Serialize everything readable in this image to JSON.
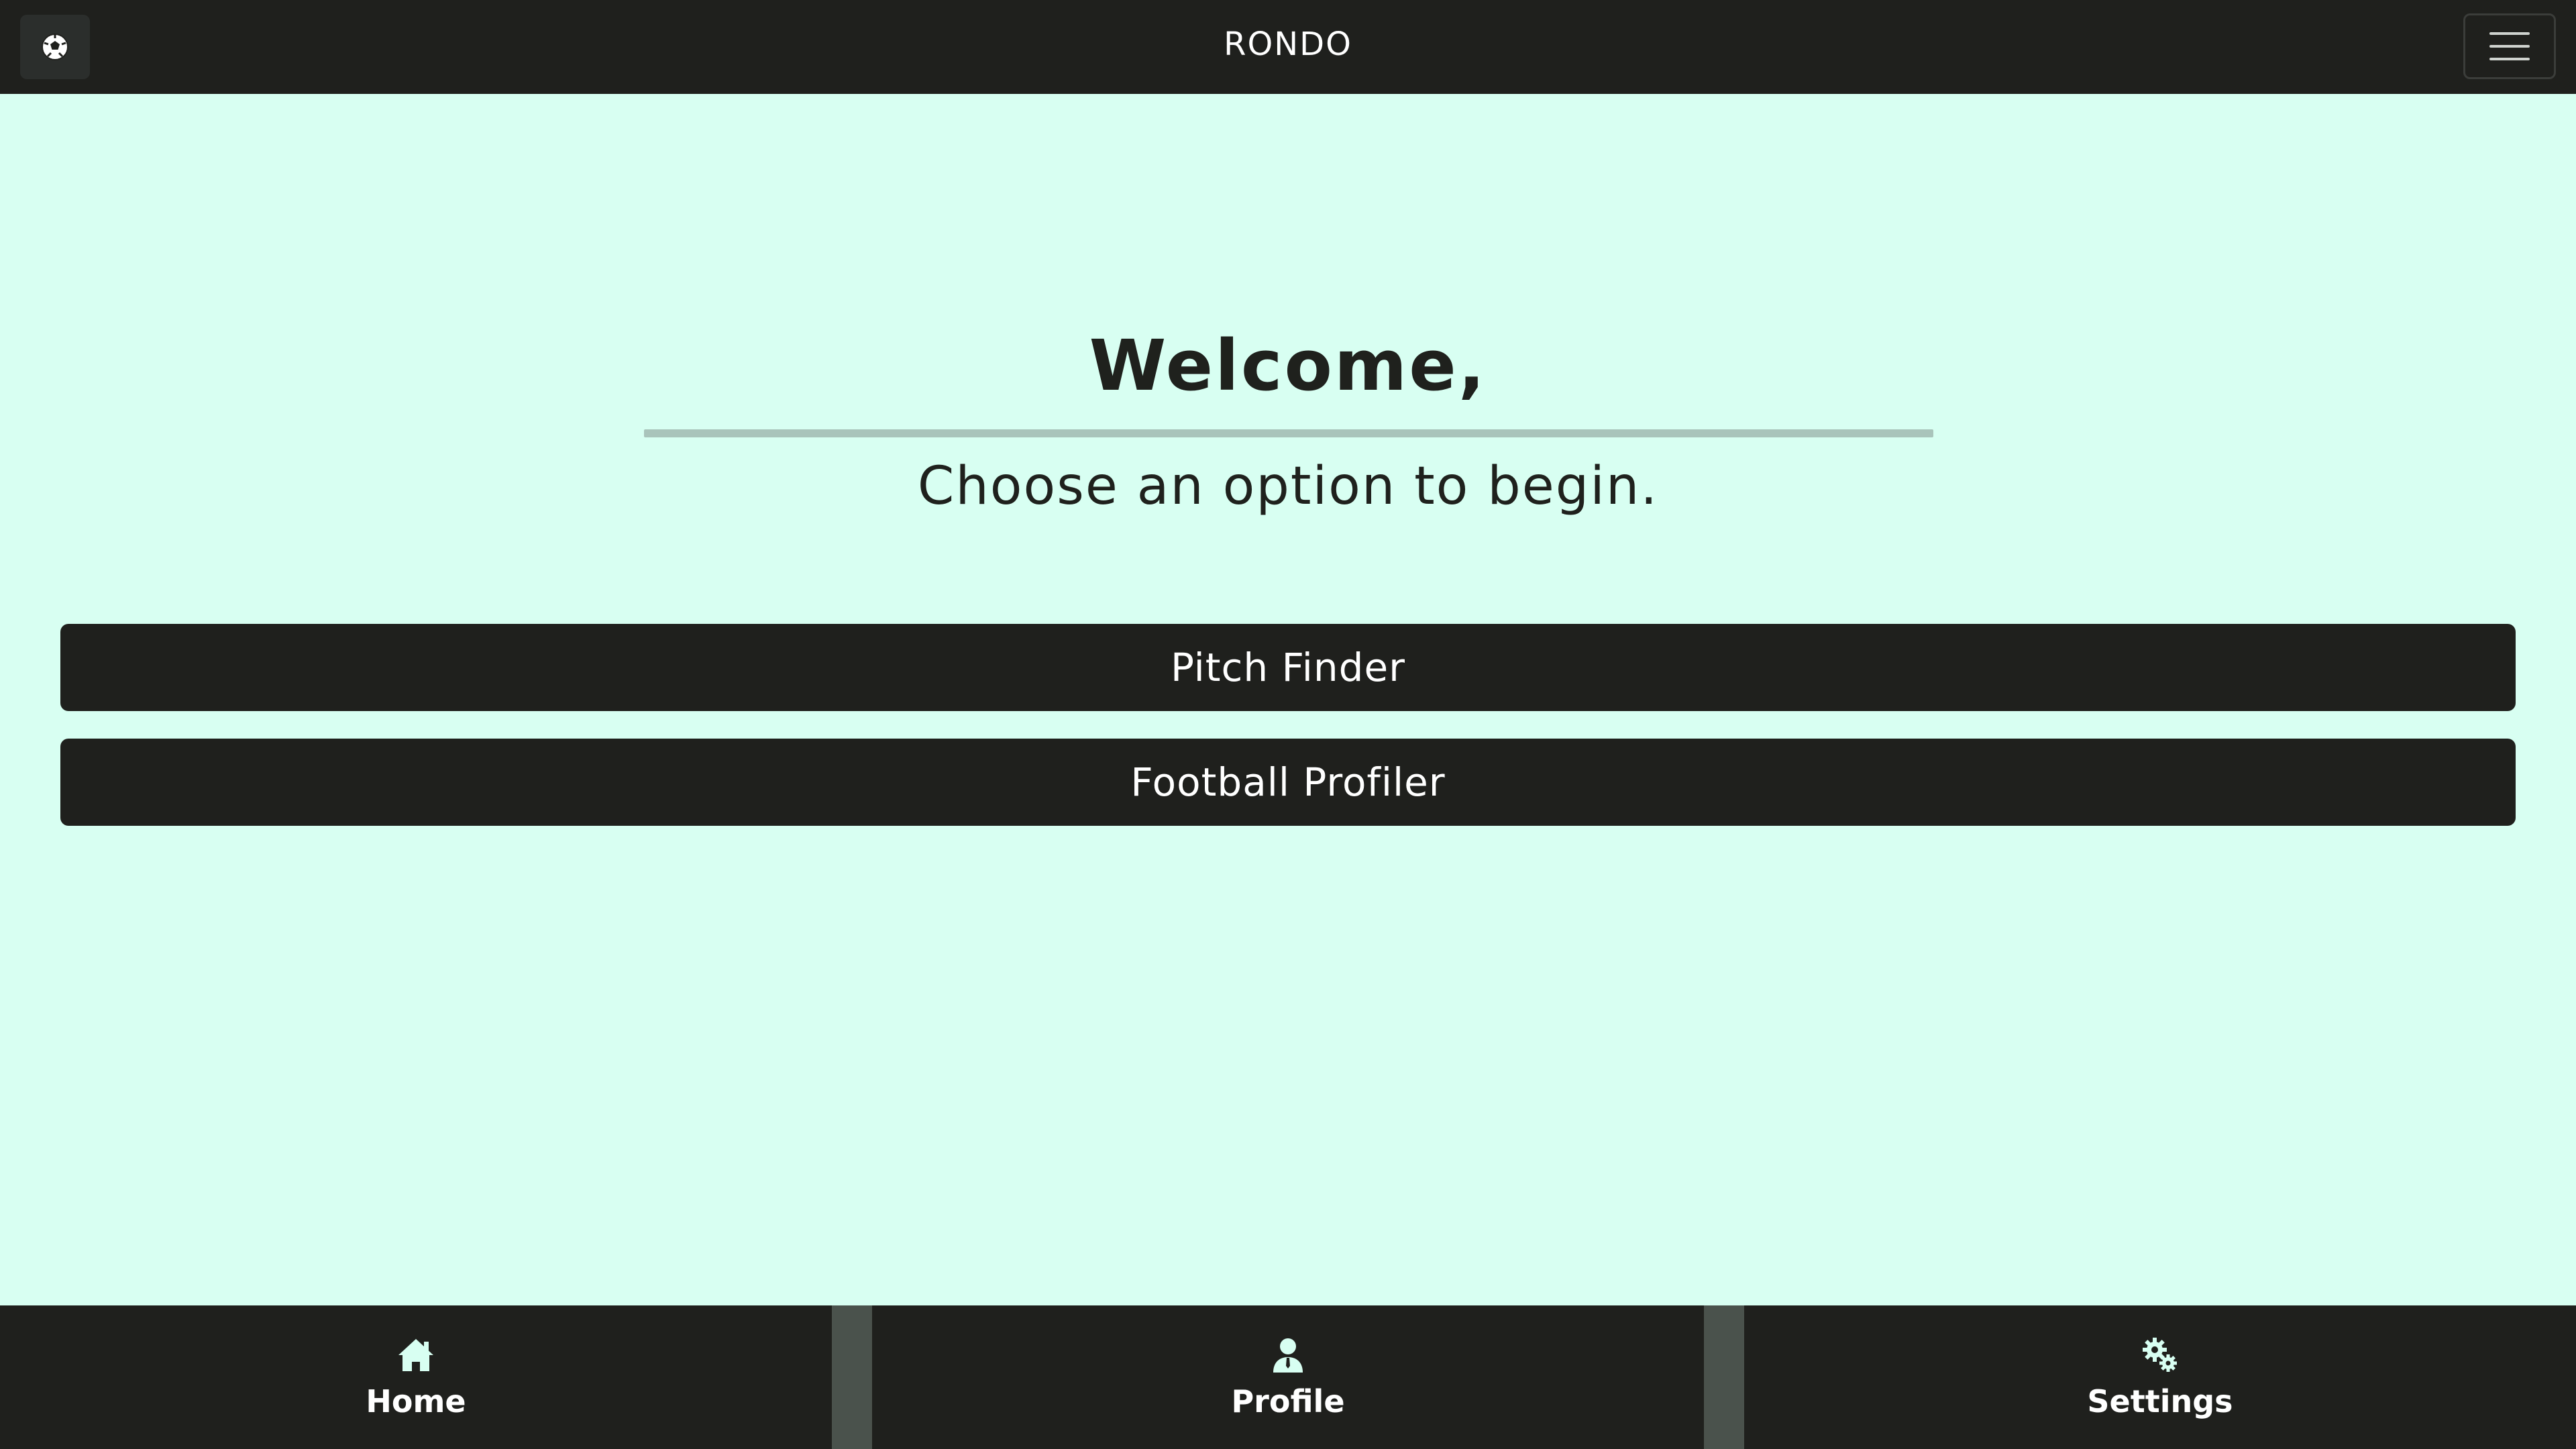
{
  "header": {
    "title": "RONDO",
    "logo_icon": "soccer-ball-icon",
    "menu_icon": "hamburger-menu-icon"
  },
  "main": {
    "heading": "Welcome,",
    "subheading": "Choose an option to begin.",
    "actions": [
      {
        "label": "Pitch Finder"
      },
      {
        "label": "Football Profiler"
      }
    ]
  },
  "bottom_nav": {
    "items": [
      {
        "label": "Home",
        "icon": "home-icon"
      },
      {
        "label": "Profile",
        "icon": "user-icon"
      },
      {
        "label": "Settings",
        "icon": "gears-icon"
      }
    ]
  },
  "colors": {
    "background": "#d8fff2",
    "dark": "#1f201d",
    "divider": "#a9c4bb",
    "nav_separator": "#4a524c",
    "icon_tint": "#d8fff2"
  }
}
